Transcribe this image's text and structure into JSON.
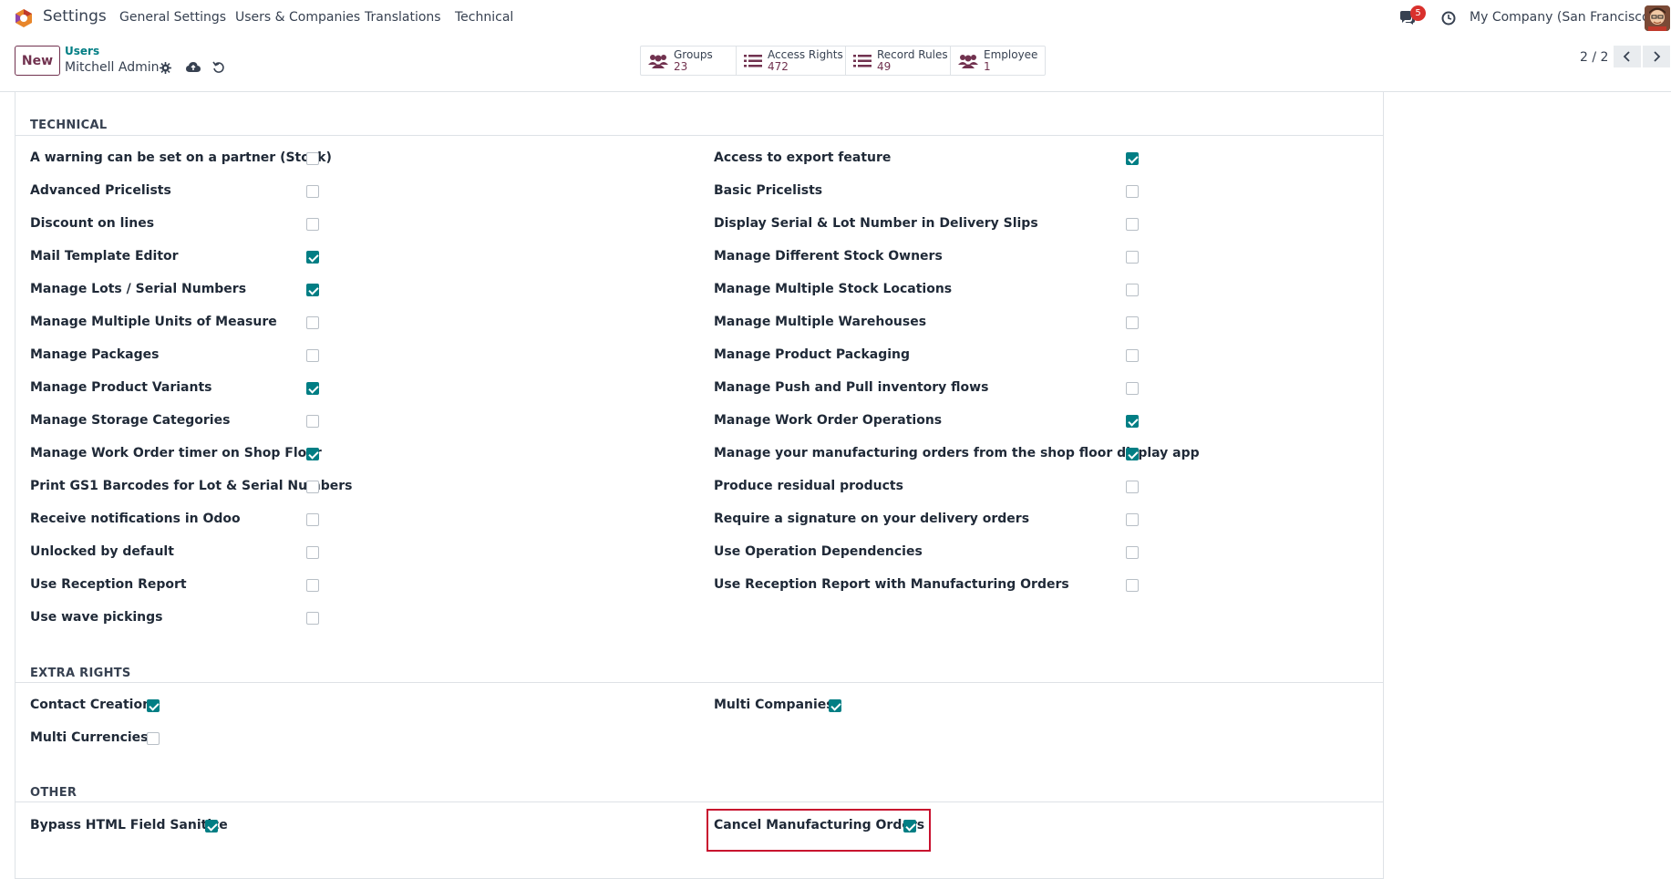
{
  "navbar": {
    "app_name": "Settings",
    "menu": [
      "General Settings",
      "Users & Companies",
      "Translations",
      "Technical"
    ],
    "chat_badge": "5",
    "company": "My Company (San Francisco)"
  },
  "control": {
    "new_label": "New",
    "breadcrumb_parent": "Users",
    "breadcrumb_current": "Mitchell Admin",
    "smart_buttons": [
      {
        "label": "Groups",
        "value": "23"
      },
      {
        "label": "Access Rights",
        "value": "472"
      },
      {
        "label": "Record Rules",
        "value": "49"
      },
      {
        "label": "Employee",
        "value": "1"
      }
    ],
    "pager": "2 / 2"
  },
  "technical": {
    "title": "TECHNICAL",
    "left": [
      {
        "label": "A warning can be set on a partner (Stock)",
        "checked": false
      },
      {
        "label": "Advanced Pricelists",
        "checked": false
      },
      {
        "label": "Discount on lines",
        "checked": false
      },
      {
        "label": "Mail Template Editor",
        "checked": true
      },
      {
        "label": "Manage Lots / Serial Numbers",
        "checked": true
      },
      {
        "label": "Manage Multiple Units of Measure",
        "checked": false
      },
      {
        "label": "Manage Packages",
        "checked": false
      },
      {
        "label": "Manage Product Variants",
        "checked": true
      },
      {
        "label": "Manage Storage Categories",
        "checked": false
      },
      {
        "label": "Manage Work Order timer on Shop Floor",
        "checked": true
      },
      {
        "label": "Print GS1 Barcodes for Lot & Serial Numbers",
        "checked": false
      },
      {
        "label": "Receive notifications in Odoo",
        "checked": false
      },
      {
        "label": "Unlocked by default",
        "checked": false
      },
      {
        "label": "Use Reception Report",
        "checked": false
      },
      {
        "label": "Use wave pickings",
        "checked": false
      }
    ],
    "right": [
      {
        "label": "Access to export feature",
        "checked": true
      },
      {
        "label": "Basic Pricelists",
        "checked": false
      },
      {
        "label": "Display Serial & Lot Number in Delivery Slips",
        "checked": false
      },
      {
        "label": "Manage Different Stock Owners",
        "checked": false
      },
      {
        "label": "Manage Multiple Stock Locations",
        "checked": false
      },
      {
        "label": "Manage Multiple Warehouses",
        "checked": false
      },
      {
        "label": "Manage Product Packaging",
        "checked": false
      },
      {
        "label": "Manage Push and Pull inventory flows",
        "checked": false
      },
      {
        "label": "Manage Work Order Operations",
        "checked": true
      },
      {
        "label": "Manage your manufacturing orders from the shop floor display app",
        "checked": true
      },
      {
        "label": "Produce residual products",
        "checked": false
      },
      {
        "label": "Require a signature on your delivery orders",
        "checked": false
      },
      {
        "label": "Use Operation Dependencies",
        "checked": false
      },
      {
        "label": "Use Reception Report with Manufacturing Orders",
        "checked": false
      }
    ]
  },
  "extra_rights": {
    "title": "EXTRA RIGHTS",
    "left": [
      {
        "label": "Contact Creation",
        "checked": true
      },
      {
        "label": "Multi Currencies",
        "checked": false
      }
    ],
    "right": [
      {
        "label": "Multi Companies",
        "checked": true
      }
    ]
  },
  "other": {
    "title": "OTHER",
    "left": [
      {
        "label": "Bypass HTML Field Sanitize",
        "checked": true
      }
    ],
    "right": [
      {
        "label": "Cancel Manufacturing Orders",
        "checked": true
      }
    ]
  },
  "colors": {
    "brand": "#71324f",
    "checkbox_checked": "#017e84",
    "highlight": "#c8102e"
  }
}
